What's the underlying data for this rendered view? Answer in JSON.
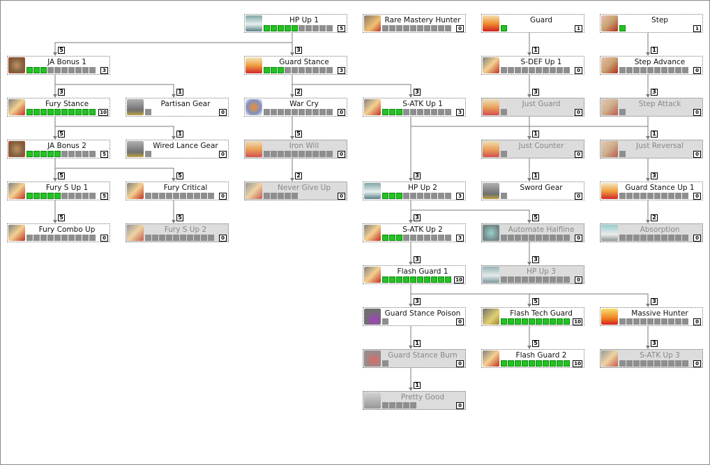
{
  "colors": {
    "learned": "#22c322",
    "unlearned": "#8e8e8e",
    "locked_bg": "#dcdcdc",
    "line": "#7a7a7a"
  },
  "nodes": [
    {
      "id": "hp1",
      "name": "HP Up 1",
      "col": 2,
      "row": 0,
      "max": 10,
      "level": 5,
      "locked": false,
      "icon": "hp-icon"
    },
    {
      "id": "rmh",
      "name": "Rare Mastery Hunter",
      "col": 3,
      "row": 0,
      "max": 10,
      "level": 0,
      "locked": false,
      "icon": "sword-star-icon"
    },
    {
      "id": "guard",
      "name": "Guard",
      "col": 4,
      "row": 0,
      "max": 1,
      "level": 1,
      "locked": false,
      "icon": "guard-icon"
    },
    {
      "id": "step",
      "name": "Step",
      "col": 5,
      "row": 0,
      "max": 1,
      "level": 1,
      "locked": false,
      "icon": "step-icon"
    },
    {
      "id": "jab1",
      "name": "JA Bonus 1",
      "col": 0,
      "row": 1,
      "max": 10,
      "level": 3,
      "locked": false,
      "icon": "ja-icon"
    },
    {
      "id": "gs",
      "name": "Guard Stance",
      "col": 2,
      "row": 1,
      "max": 10,
      "level": 3,
      "locked": false,
      "icon": "guard-stance-icon"
    },
    {
      "id": "sdef1",
      "name": "S-DEF Up 1",
      "col": 4,
      "row": 1,
      "max": 10,
      "level": 0,
      "locked": false,
      "icon": "sword-icon"
    },
    {
      "id": "stepadv",
      "name": "Step Advance",
      "col": 5,
      "row": 1,
      "max": 10,
      "level": 0,
      "locked": false,
      "icon": "step-icon"
    },
    {
      "id": "fury",
      "name": "Fury Stance",
      "col": 0,
      "row": 2,
      "max": 10,
      "level": 10,
      "locked": false,
      "icon": "sword-icon"
    },
    {
      "id": "partisan",
      "name": "Partisan Gear",
      "col": 1,
      "row": 2,
      "max": 1,
      "level": 0,
      "locked": false,
      "icon": "gear-icon"
    },
    {
      "id": "warcry",
      "name": "War Cry",
      "col": 2,
      "row": 2,
      "max": 10,
      "level": 0,
      "locked": false,
      "icon": "war-cry-icon"
    },
    {
      "id": "satk1",
      "name": "S-ATK Up 1",
      "col": 3,
      "row": 2,
      "max": 10,
      "level": 3,
      "locked": false,
      "icon": "sword-icon"
    },
    {
      "id": "justguard",
      "name": "Just Guard",
      "col": 4,
      "row": 2,
      "max": 1,
      "level": 0,
      "locked": true,
      "icon": "guard-icon"
    },
    {
      "id": "stepatk",
      "name": "Step Attack",
      "col": 5,
      "row": 2,
      "max": 1,
      "level": 0,
      "locked": true,
      "icon": "step-icon"
    },
    {
      "id": "jab2",
      "name": "JA Bonus 2",
      "col": 0,
      "row": 3,
      "max": 10,
      "level": 5,
      "locked": false,
      "icon": "ja-icon"
    },
    {
      "id": "wired",
      "name": "Wired Lance Gear",
      "col": 1,
      "row": 3,
      "max": 1,
      "level": 0,
      "locked": false,
      "icon": "gear-icon"
    },
    {
      "id": "ironwill",
      "name": "Iron Will",
      "col": 2,
      "row": 3,
      "max": 10,
      "level": 0,
      "locked": true,
      "icon": "guard-icon"
    },
    {
      "id": "justcounter",
      "name": "Just Counter",
      "col": 4,
      "row": 3,
      "max": 1,
      "level": 0,
      "locked": true,
      "icon": "guard-icon"
    },
    {
      "id": "justrev",
      "name": "Just Reversal",
      "col": 5,
      "row": 3,
      "max": 1,
      "level": 0,
      "locked": true,
      "icon": "step-icon"
    },
    {
      "id": "furys1",
      "name": "Fury S Up 1",
      "col": 0,
      "row": 4,
      "max": 10,
      "level": 5,
      "locked": false,
      "icon": "sword-icon"
    },
    {
      "id": "furycrit",
      "name": "Fury Critical",
      "col": 1,
      "row": 4,
      "max": 10,
      "level": 0,
      "locked": false,
      "icon": "sword-icon"
    },
    {
      "id": "ngu",
      "name": "Never Give Up",
      "col": 2,
      "row": 4,
      "max": 5,
      "level": 0,
      "locked": true,
      "icon": "sword-icon"
    },
    {
      "id": "hp2",
      "name": "HP Up 2",
      "col": 3,
      "row": 4,
      "max": 10,
      "level": 3,
      "locked": false,
      "icon": "hp-icon"
    },
    {
      "id": "swordgear",
      "name": "Sword Gear",
      "col": 4,
      "row": 4,
      "max": 1,
      "level": 0,
      "locked": false,
      "icon": "gear-icon"
    },
    {
      "id": "gsu1",
      "name": "Guard Stance Up 1",
      "col": 5,
      "row": 4,
      "max": 10,
      "level": 0,
      "locked": false,
      "icon": "guard-stance-icon"
    },
    {
      "id": "furycombo",
      "name": "Fury Combo Up",
      "col": 0,
      "row": 5,
      "max": 10,
      "level": 0,
      "locked": false,
      "icon": "sword-icon"
    },
    {
      "id": "furys2",
      "name": "Fury S Up 2",
      "col": 1,
      "row": 5,
      "max": 10,
      "level": 0,
      "locked": true,
      "icon": "sword-icon"
    },
    {
      "id": "satk2",
      "name": "S-ATK Up 2",
      "col": 3,
      "row": 5,
      "max": 10,
      "level": 3,
      "locked": false,
      "icon": "sword-icon"
    },
    {
      "id": "autohalf",
      "name": "Automate Halfline",
      "col": 4,
      "row": 5,
      "max": 10,
      "level": 0,
      "locked": true,
      "icon": "automate-icon"
    },
    {
      "id": "absorb",
      "name": "Absorption",
      "col": 5,
      "row": 5,
      "max": 10,
      "level": 0,
      "locked": true,
      "icon": "absorption-icon"
    },
    {
      "id": "fg1",
      "name": "Flash Guard 1",
      "col": 3,
      "row": 6,
      "max": 10,
      "level": 10,
      "locked": false,
      "icon": "sword-icon"
    },
    {
      "id": "hp3",
      "name": "HP Up 3",
      "col": 4,
      "row": 6,
      "max": 10,
      "level": 0,
      "locked": true,
      "icon": "hp-icon"
    },
    {
      "id": "gsp",
      "name": "Guard Stance Poison",
      "col": 3,
      "row": 7,
      "max": 1,
      "level": 0,
      "locked": false,
      "icon": "poison-icon"
    },
    {
      "id": "ftg",
      "name": "Flash Tech Guard",
      "col": 4,
      "row": 7,
      "max": 10,
      "level": 10,
      "locked": false,
      "icon": "tech-guard-icon"
    },
    {
      "id": "massive",
      "name": "Massive Hunter",
      "col": 5,
      "row": 7,
      "max": 10,
      "level": 0,
      "locked": false,
      "icon": "massive-icon"
    },
    {
      "id": "gsb",
      "name": "Guard Stance Burn",
      "col": 3,
      "row": 8,
      "max": 1,
      "level": 0,
      "locked": true,
      "icon": "burn-icon"
    },
    {
      "id": "fg2",
      "name": "Flash Guard 2",
      "col": 4,
      "row": 8,
      "max": 10,
      "level": 10,
      "locked": false,
      "icon": "sword-icon"
    },
    {
      "id": "satk3",
      "name": "S-ATK Up 3",
      "col": 5,
      "row": 8,
      "max": 10,
      "level": 0,
      "locked": true,
      "icon": "sword-icon"
    },
    {
      "id": "prettygood",
      "name": "Pretty Good",
      "col": 3,
      "row": 9,
      "max": 5,
      "level": 0,
      "locked": true,
      "icon": "pretty-good-icon"
    }
  ],
  "edges": [
    {
      "from": "hp1",
      "to": "jab1",
      "req": 5
    },
    {
      "from": "hp1",
      "to": "gs",
      "req": 3
    },
    {
      "from": "jab1",
      "to": "fury",
      "req": 3
    },
    {
      "from": "jab1",
      "to": "partisan",
      "req": 1
    },
    {
      "from": "fury",
      "to": "jab2",
      "req": 5
    },
    {
      "from": "fury",
      "to": "wired",
      "req": 1
    },
    {
      "from": "jab2",
      "to": "furys1",
      "req": 5
    },
    {
      "from": "jab2",
      "to": "furycrit",
      "req": 5
    },
    {
      "from": "furys1",
      "to": "furycombo",
      "req": 5
    },
    {
      "from": "furycrit",
      "to": "furys2",
      "req": 5
    },
    {
      "from": "gs",
      "to": "warcry",
      "req": 2
    },
    {
      "from": "gs",
      "to": "satk1",
      "req": 3
    },
    {
      "from": "warcry",
      "to": "ironwill",
      "req": 5
    },
    {
      "from": "ironwill",
      "to": "ngu",
      "req": 2
    },
    {
      "from": "satk1",
      "to": "hp2",
      "req": 3
    },
    {
      "from": "satk1",
      "to": "swordgear",
      "req": 1
    },
    {
      "from": "satk1",
      "to": "gsu1",
      "req": 3
    },
    {
      "from": "guard",
      "to": "sdef1",
      "req": 1
    },
    {
      "from": "sdef1",
      "to": "justguard",
      "req": 3
    },
    {
      "from": "justguard",
      "to": "justcounter",
      "req": 1
    },
    {
      "from": "step",
      "to": "stepadv",
      "req": 1
    },
    {
      "from": "stepadv",
      "to": "stepatk",
      "req": 3
    },
    {
      "from": "stepatk",
      "to": "justrev",
      "req": 1
    },
    {
      "from": "hp2",
      "to": "satk2",
      "req": 3
    },
    {
      "from": "hp2",
      "to": "autohalf",
      "req": 5
    },
    {
      "from": "gsu1",
      "to": "absorb",
      "req": 2
    },
    {
      "from": "satk2",
      "to": "fg1",
      "req": 3
    },
    {
      "from": "autohalf",
      "to": "hp3",
      "req": 3
    },
    {
      "from": "fg1",
      "to": "gsp",
      "req": 3
    },
    {
      "from": "fg1",
      "to": "ftg",
      "req": 5
    },
    {
      "from": "fg1",
      "to": "massive",
      "req": 3
    },
    {
      "from": "gsp",
      "to": "gsb",
      "req": 1
    },
    {
      "from": "gsb",
      "to": "prettygood",
      "req": 1
    },
    {
      "from": "ftg",
      "to": "fg2",
      "req": 5
    },
    {
      "from": "massive",
      "to": "satk3",
      "req": 3
    }
  ]
}
